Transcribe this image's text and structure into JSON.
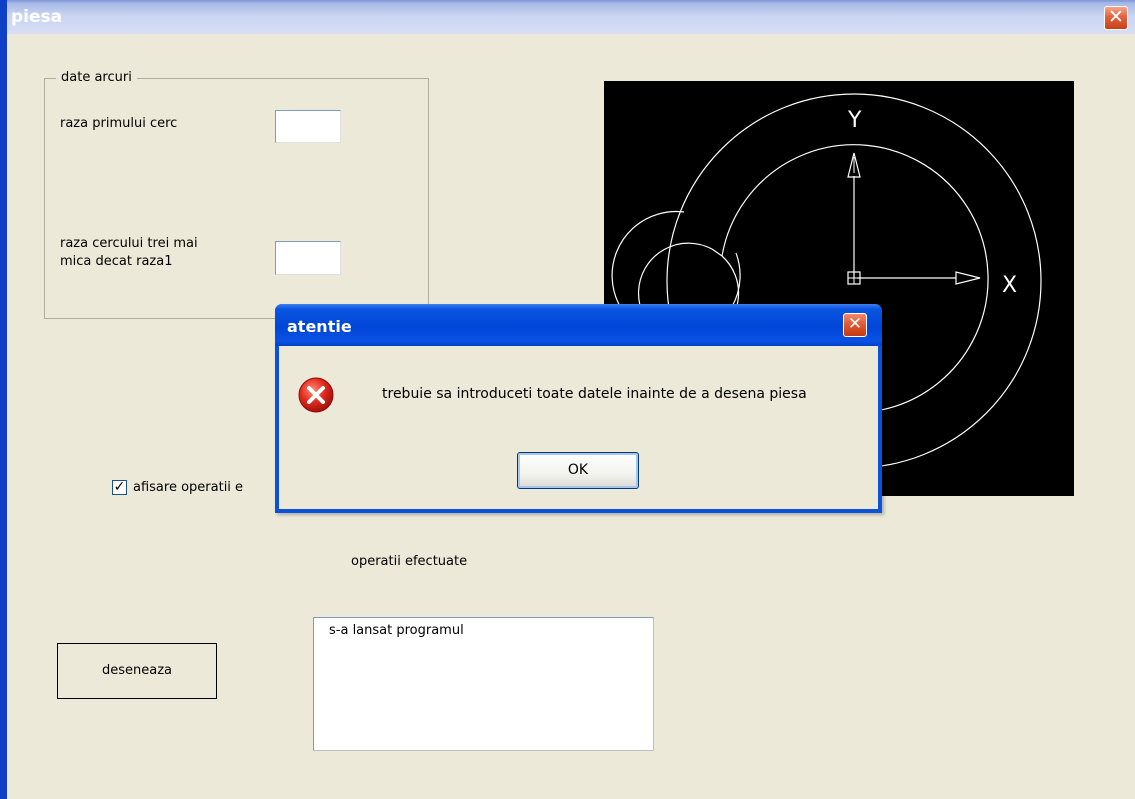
{
  "window": {
    "title": "piesa",
    "close_glyph": "✕"
  },
  "groupbox": {
    "legend": "date arcuri",
    "raza1_label": "raza primului cerc",
    "raza3_label_line1": "raza cercului trei mai",
    "raza3_label_line2": "mica decat raza1",
    "raza1_value": "",
    "raza3_value": ""
  },
  "canvas": {
    "axis_y_label": "Y",
    "axis_x_label": "X"
  },
  "checkbox": {
    "label": "afisare operatii e",
    "checked": true,
    "mark": "✓"
  },
  "operations_label": "operatii efectuate",
  "draw_button_label": "deseneaza",
  "operations_list": [
    "s-a lansat programul"
  ],
  "dialog": {
    "title": "atentie",
    "message": "trebuie sa introduceti toate datele inainte de a desena piesa",
    "ok_label": "OK",
    "icon": "error-icon",
    "close_glyph": "✕"
  },
  "colors": {
    "titlebar_active": "#0a52d9",
    "face": "#ece9d8",
    "canvas_bg": "#000000",
    "error_red": "#d42121"
  }
}
